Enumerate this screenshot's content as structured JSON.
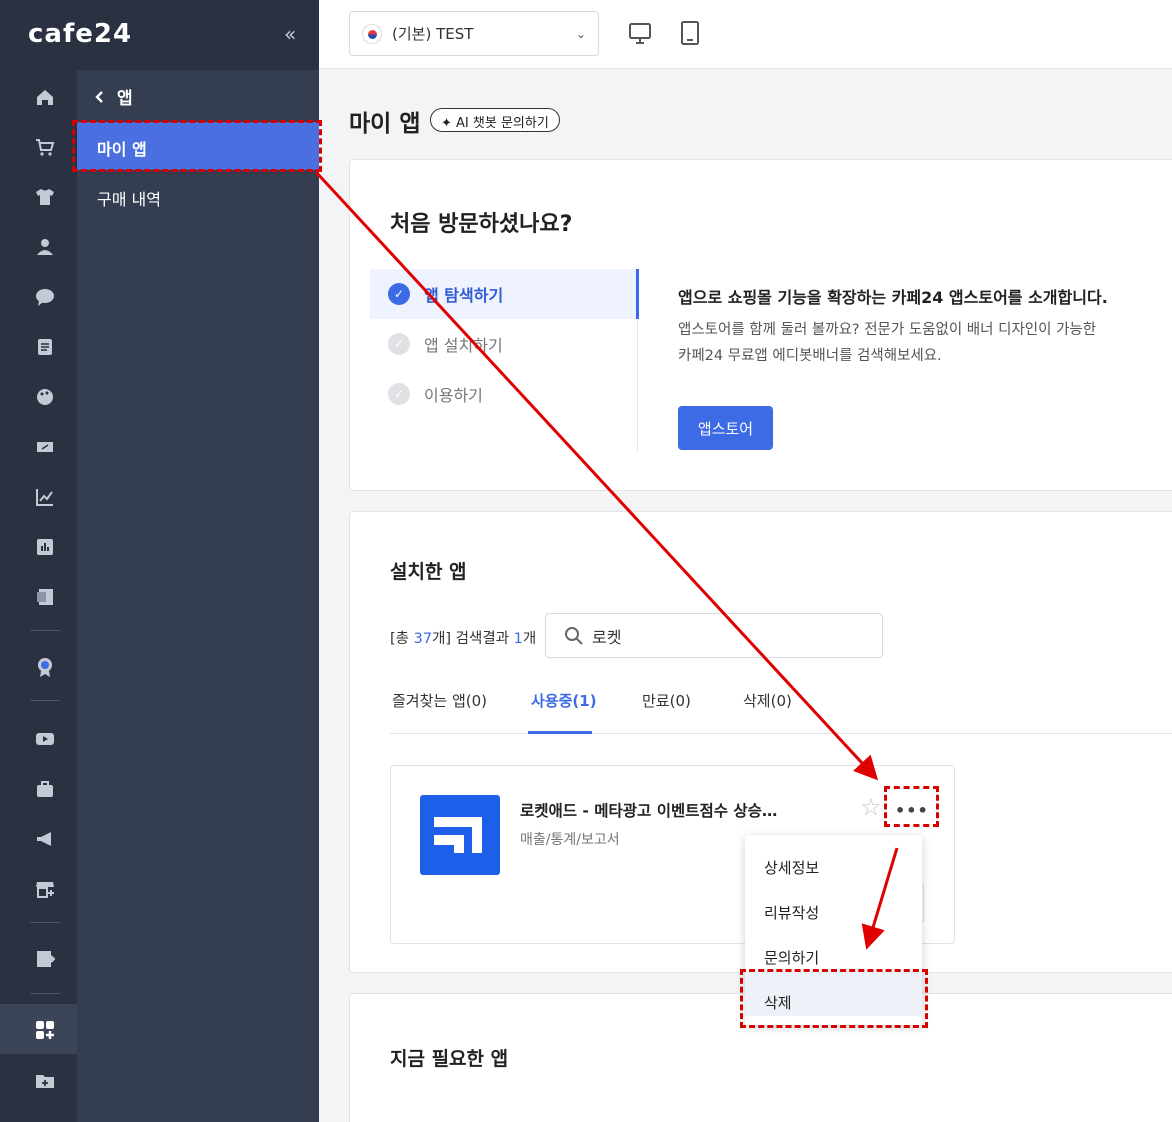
{
  "brand": {
    "logo": "cafe24",
    "collapse": "«"
  },
  "nav_icons": [
    "home-icon",
    "cart-icon",
    "shirt-icon",
    "user-icon",
    "chat-icon",
    "board-icon",
    "palette-icon",
    "coupon-icon",
    "chart-icon",
    "report-icon",
    "excel-icon",
    "badge-icon",
    "youtube-icon",
    "briefcase-icon",
    "megaphone-icon",
    "store-icon",
    "export-icon",
    "apps-icon",
    "folder-icon"
  ],
  "subnav": {
    "back_label": "앱",
    "items": [
      "마이 앱",
      "구매 내역"
    ]
  },
  "topbar": {
    "shop": "(기본) TEST"
  },
  "page": {
    "title": "마이 앱",
    "ai_button": "AI 챗봇 문의하기"
  },
  "intro": {
    "title": "처음 방문하셨나요?",
    "steps": [
      "앱 탐색하기",
      "앱 설치하기",
      "이용하기"
    ],
    "heading": "앱으로 쇼핑몰 기능을 확장하는 카페24 앱스토어를 소개합니다.",
    "desc_line1": "앱스토어를 함께 둘러 볼까요? 전문가 도움없이 배너 디자인이 가능한",
    "desc_line2": "카페24 무료앱 에디봇배너를 검색해보세요.",
    "button": "앱스토어"
  },
  "installed": {
    "title": "설치한 앱",
    "count_prefix": "[총 ",
    "total": "37",
    "count_mid": "개] 검색결과 ",
    "result": "1",
    "count_suffix": "개",
    "search_value": "로켓",
    "tabs": [
      "즐겨찾는 앱(0)",
      "사용중(1)",
      "만료(0)",
      "삭제(0)"
    ],
    "active_tab": 1,
    "app": {
      "name": "로켓애드 - 메타광고 이벤트점수 상승…",
      "category": "매출/통계/보고서"
    },
    "menu": [
      "상세정보",
      "리뷰작성",
      "문의하기",
      "삭제"
    ]
  },
  "needed": {
    "title": "지금 필요한 앱"
  },
  "colors": {
    "accent": "#3d6be6",
    "sidebar": "#2a3140",
    "annotation": "#d60000"
  }
}
